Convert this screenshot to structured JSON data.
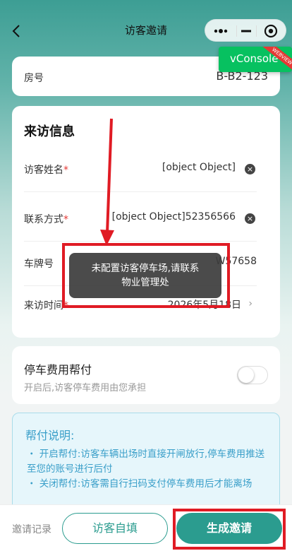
{
  "nav": {
    "title": "访客邀请"
  },
  "vconsole": {
    "label": "vConsole",
    "ribbon": "WEBVIEW"
  },
  "room": {
    "label": "房号",
    "value": "B-B2-123"
  },
  "visit": {
    "title": "来访信息",
    "fields": [
      {
        "label": "访客姓名",
        "value": "[object Object]"
      },
      {
        "label": "联系方式",
        "value": "[object Object]52356566"
      },
      {
        "label": "车牌号",
        "value": "W57658"
      },
      {
        "label": "来访时间",
        "value": "2026年5月18日"
      }
    ],
    "required_mark": "*"
  },
  "subsidy": {
    "title": "停车费用帮付",
    "desc": "开启后,访客停车费用由您承担",
    "enabled": false
  },
  "info": {
    "title": "帮付说明:",
    "items": [
      "・ 开启帮付:访客车辆出场时直接开闸放行,停车费用推送至您的账号进行后付",
      "・ 关闭帮付:访客需自行扫码支付停车费用后才能离场"
    ]
  },
  "bottom": {
    "record_label": "邀请记录",
    "self_fill_label": "访客自填",
    "generate_label": "生成邀请"
  },
  "toast": {
    "line1": "未配置访客停车场,请联系",
    "line2": "物业管理处"
  },
  "colors": {
    "primary": "#2b9c8f",
    "annotation": "#e01b24",
    "info_text": "#3a9fc9"
  }
}
